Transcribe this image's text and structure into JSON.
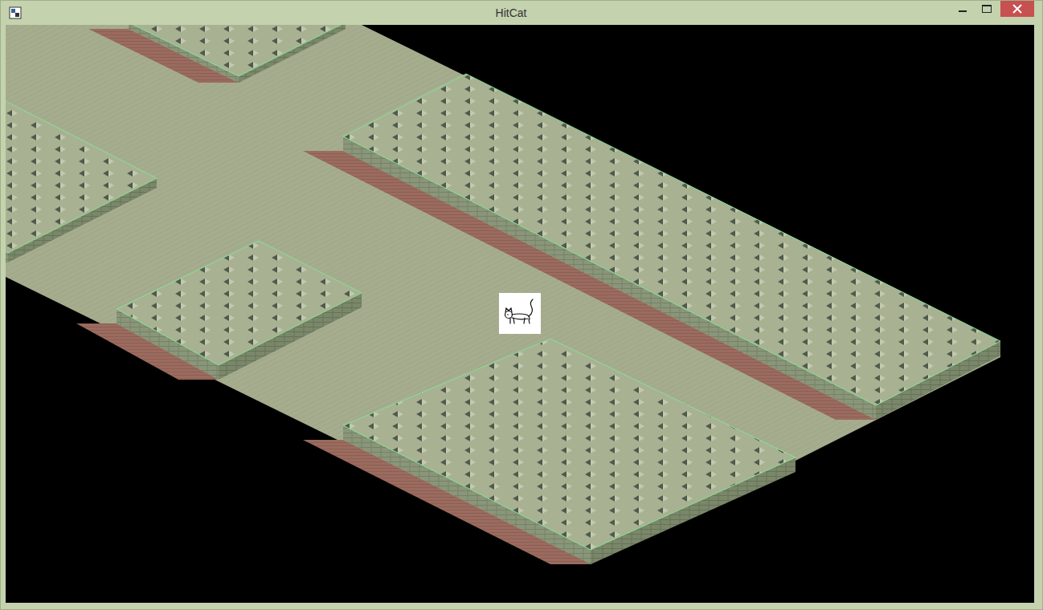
{
  "window": {
    "title": "HitCat"
  }
}
